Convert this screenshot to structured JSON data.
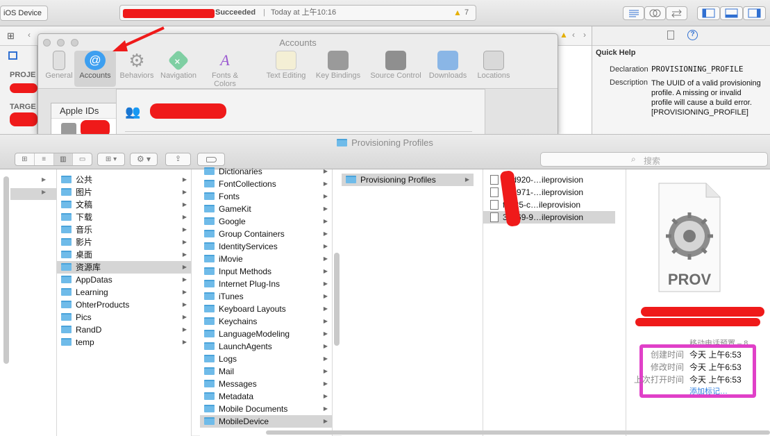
{
  "xcode": {
    "scheme": "iOS Device",
    "activity_status": "Succeeded",
    "activity_time": "Today at 上午10:16",
    "warning_count": "7",
    "quick_help": {
      "title": "Quick Help",
      "declaration_label": "Declaration",
      "declaration_value": "PROVISIONING_PROFILE",
      "description_label": "Description",
      "description_value": "The UUID of a valid provisioning profile. A missing or invalid profile will cause a build error. [PROVISIONING_PROFILE]"
    },
    "nav_labels": {
      "project": "PROJE",
      "targets": "TARGE"
    }
  },
  "accounts": {
    "title": "Accounts",
    "tabs": [
      {
        "label": "General",
        "icon": "phone-icon"
      },
      {
        "label": "Accounts",
        "icon": "at-icon"
      },
      {
        "label": "Behaviors",
        "icon": "gear-icon"
      },
      {
        "label": "Navigation",
        "icon": "navigation-icon"
      },
      {
        "label": "Fonts & Colors",
        "icon": "fonts-icon"
      },
      {
        "label": "Text Editing",
        "icon": "text-editing-icon"
      },
      {
        "label": "Key Bindings",
        "icon": "keyboard-icon"
      },
      {
        "label": "Source Control",
        "icon": "safe-icon"
      },
      {
        "label": "Downloads",
        "icon": "download-icon"
      },
      {
        "label": "Locations",
        "icon": "joystick-icon"
      }
    ],
    "apple_ids_header": "Apple IDs"
  },
  "finder": {
    "title": "Provisioning Profiles",
    "search_placeholder": "搜索",
    "column1": [
      "公共",
      "图片",
      "文稿",
      "下载",
      "音乐",
      "影片",
      "桌面",
      "资源库",
      "AppDatas",
      "Learning",
      "OhterProducts",
      "Pics",
      "RandD",
      "temp"
    ],
    "column2": [
      "Dictionaries",
      "FontCollections",
      "Fonts",
      "GameKit",
      "Google",
      "Group Containers",
      "IdentityServices",
      "iMovie",
      "Input Methods",
      "Internet Plug-Ins",
      "iTunes",
      "Keyboard Layouts",
      "Keychains",
      "LanguageModeling",
      "LaunchAgents",
      "Logs",
      "Mail",
      "Messages",
      "Metadata",
      "Mobile Documents",
      "MobileDevice"
    ],
    "column3": [
      "Provisioning Profiles"
    ],
    "column4": [
      "ded920-…ileprovision",
      "e6e971-…ileprovision",
      "f6825-c…ileprovision",
      "3be69-9…ileprovision"
    ],
    "preview": {
      "icon_label": "PROV",
      "kind": "移动电话预置 – 8…",
      "created_label": "创建时间",
      "created_value": "今天 上午6:53",
      "modified_label": "修改时间",
      "modified_value": "今天 上午6:53",
      "opened_label": "上次打开时间",
      "opened_value": "今天 上午6:53",
      "add_tags": "添加标记…"
    }
  },
  "colors": {
    "folder": "#6fbbe9",
    "highlight": "#d5d5d5",
    "annotation": "#e040c8",
    "redaction": "#ef1a1a"
  }
}
